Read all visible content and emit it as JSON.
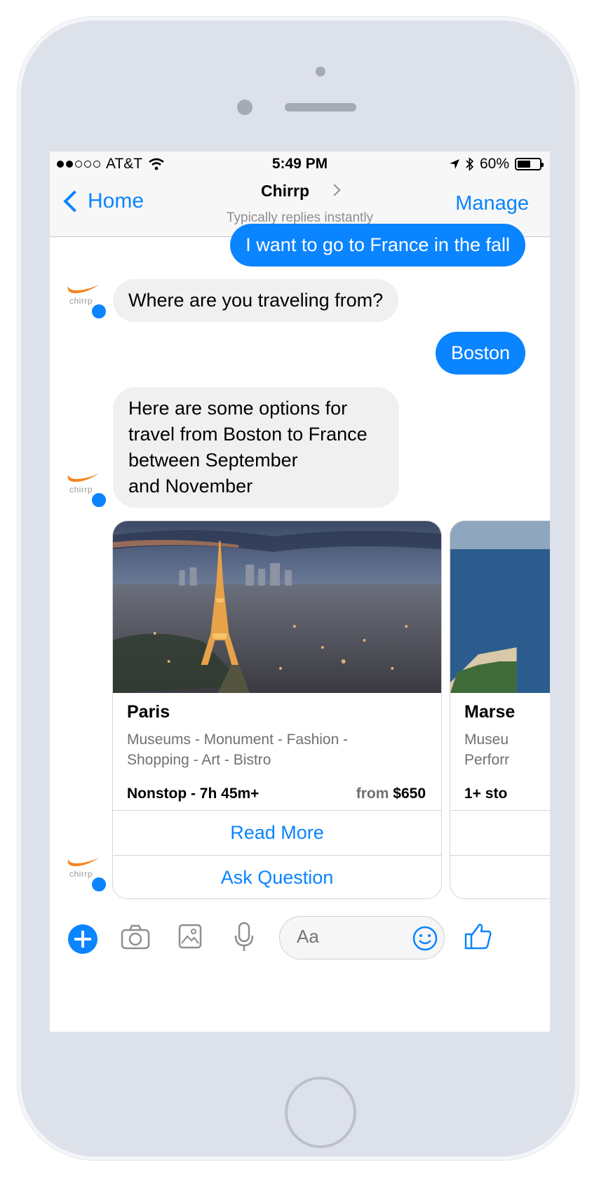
{
  "status_bar": {
    "carrier": "AT&T",
    "time": "5:49 PM",
    "battery": "60%",
    "battery_level": 0.6
  },
  "nav": {
    "back_label": "Home",
    "title": "Chirrp",
    "subtitle": "Typically replies instantly",
    "manage_label": "Manage"
  },
  "bot": {
    "avatar_label": "chirrp",
    "brand_color": "#f58220"
  },
  "messages": [
    {
      "from": "user",
      "text": "I want to go to France in the fall"
    },
    {
      "from": "bot",
      "text": "Where are you traveling from?"
    },
    {
      "from": "user",
      "text": "Boston"
    },
    {
      "from": "bot",
      "lines": [
        "Here are some options for",
        "travel from Boston to France",
        "between September",
        "and November"
      ]
    }
  ],
  "cards": [
    {
      "title": "Paris",
      "desc": [
        "Museums - Monument - Fashion -",
        "Shopping - Art - Bistro"
      ],
      "meta": "Nonstop - 7h 45m+",
      "price_prefix": "from",
      "price": "$650",
      "button1": "Read More",
      "button2": "Ask Question"
    },
    {
      "title": "Marse",
      "desc": [
        "Museu",
        "Perforr"
      ],
      "meta": "1+ sto"
    }
  ],
  "composer": {
    "placeholder": "Aa"
  },
  "colors": {
    "accent": "#0a84ff",
    "bubble_in": "#f0f0f0",
    "phone_body": "#dde1ea"
  }
}
